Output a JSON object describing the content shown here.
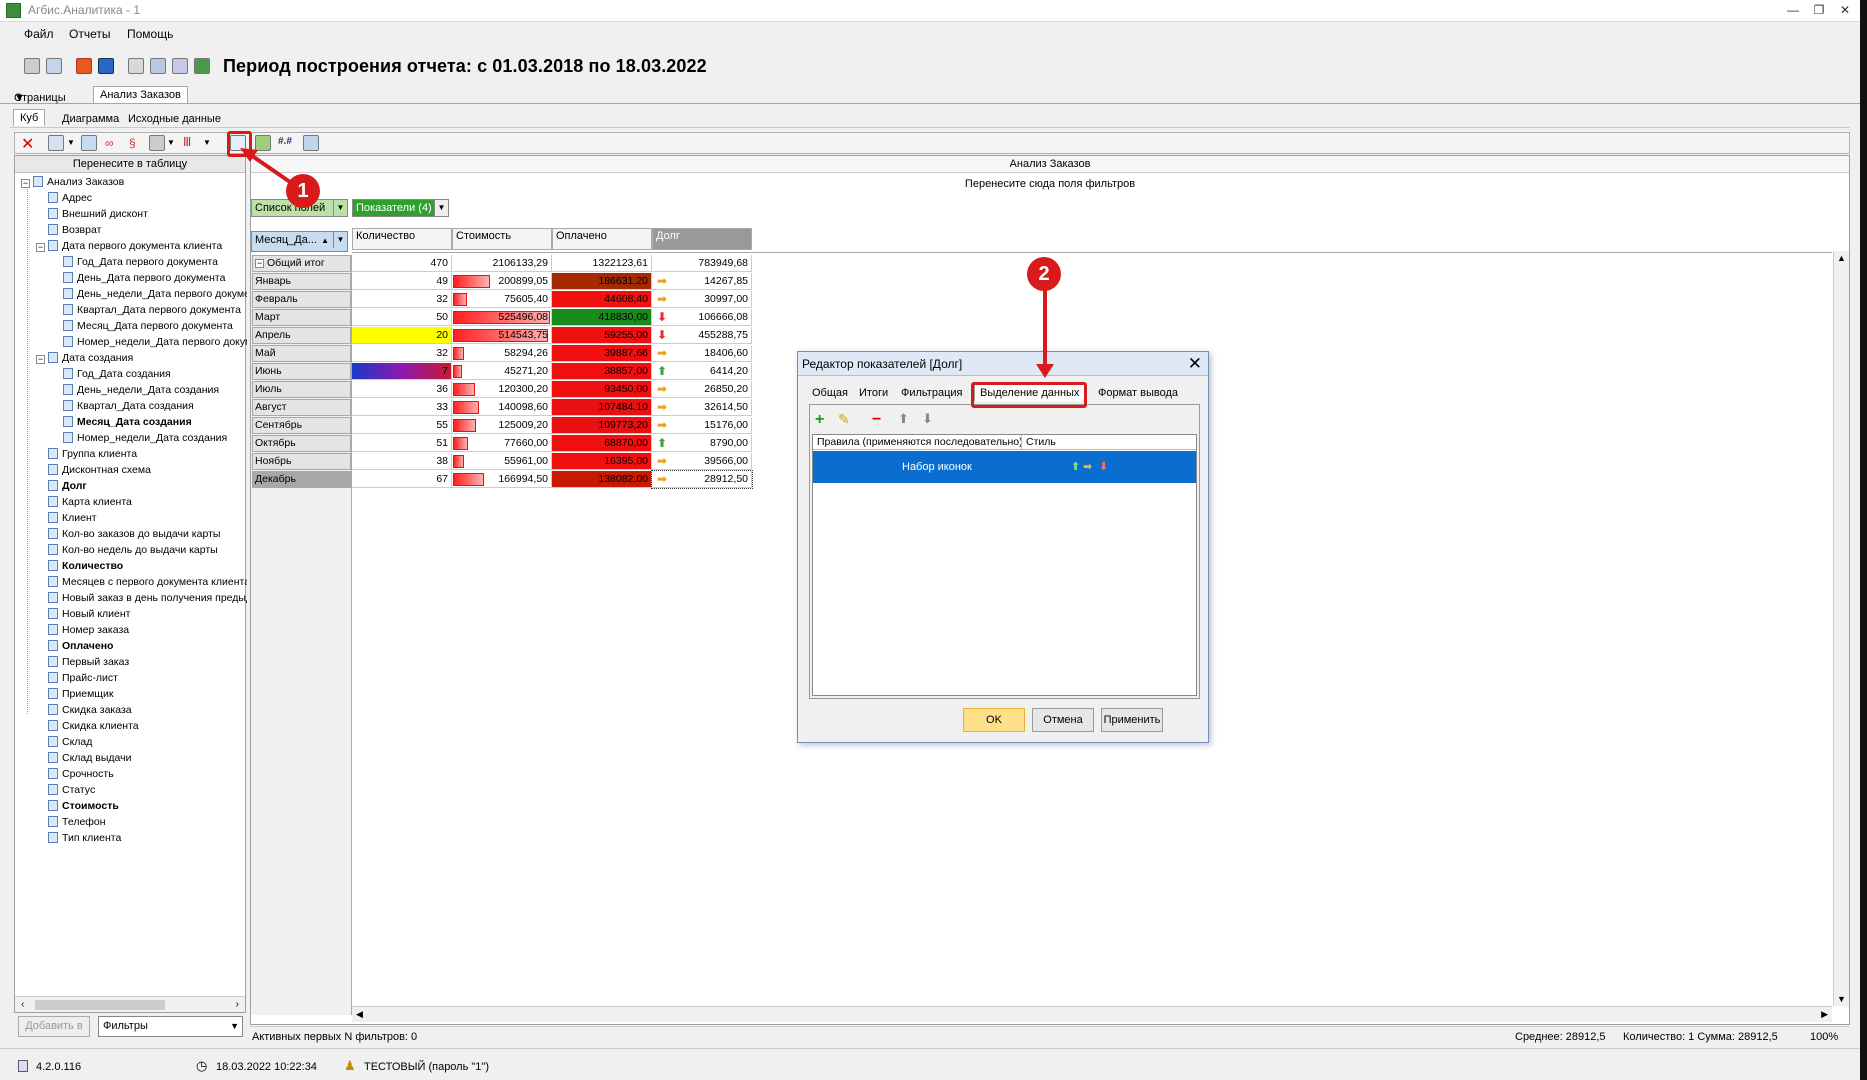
{
  "window": {
    "title": "Агбис.Аналитика - 1",
    "minimize_glyph": "—",
    "restore_glyph": "❐",
    "close_glyph": "✕"
  },
  "menu": [
    "Файл",
    "Отчеты",
    "Помощь"
  ],
  "header": {
    "period": "Период построения отчета: с 01.03.2018 по 18.03.2022"
  },
  "page_tabs": {
    "pages_label": "Страницы",
    "active": "Анализ Заказов"
  },
  "sub_tabs": [
    "Куб",
    "Диаграмма",
    "Исходные данные"
  ],
  "left_panel": {
    "header": "Перенесите в таблицу",
    "tree": [
      {
        "label": "Анализ Заказов",
        "level": 0,
        "expand": true,
        "bold": false
      },
      {
        "label": "Адрес",
        "level": 1,
        "bold": false
      },
      {
        "label": "Внешний дисконт",
        "level": 1,
        "bold": false
      },
      {
        "label": "Возврат",
        "level": 1,
        "bold": false
      },
      {
        "label": "Дата первого документа клиента",
        "level": 1,
        "expand": true,
        "bold": false
      },
      {
        "label": "Год_Дата первого документа",
        "level": 2,
        "bold": false
      },
      {
        "label": "День_Дата первого документа",
        "level": 2,
        "bold": false
      },
      {
        "label": "День_недели_Дата первого документа",
        "level": 2,
        "bold": false
      },
      {
        "label": "Квартал_Дата первого документа",
        "level": 2,
        "bold": false
      },
      {
        "label": "Месяц_Дата первого документа",
        "level": 2,
        "bold": false
      },
      {
        "label": "Номер_недели_Дата первого документа",
        "level": 2,
        "bold": false
      },
      {
        "label": "Дата создания",
        "level": 1,
        "expand": true,
        "bold": false
      },
      {
        "label": "Год_Дата создания",
        "level": 2,
        "bold": false
      },
      {
        "label": "День_недели_Дата создания",
        "level": 2,
        "bold": false
      },
      {
        "label": "Квартал_Дата создания",
        "level": 2,
        "bold": false
      },
      {
        "label": "Месяц_Дата создания",
        "level": 2,
        "bold": true
      },
      {
        "label": "Номер_недели_Дата создания",
        "level": 2,
        "bold": false
      },
      {
        "label": "Группа клиента",
        "level": 1,
        "bold": false
      },
      {
        "label": "Дисконтная схема",
        "level": 1,
        "bold": false
      },
      {
        "label": "Долг",
        "level": 1,
        "bold": true
      },
      {
        "label": "Карта клиента",
        "level": 1,
        "bold": false
      },
      {
        "label": "Клиент",
        "level": 1,
        "bold": false
      },
      {
        "label": "Кол-во заказов до выдачи карты",
        "level": 1,
        "bold": false
      },
      {
        "label": "Кол-во недель до выдачи карты",
        "level": 1,
        "bold": false
      },
      {
        "label": "Количество",
        "level": 1,
        "bold": true
      },
      {
        "label": "Месяцев с первого документа клиента",
        "level": 1,
        "bold": false
      },
      {
        "label": "Новый заказ в день получения предыдущего",
        "level": 1,
        "bold": false
      },
      {
        "label": "Новый клиент",
        "level": 1,
        "bold": false
      },
      {
        "label": "Номер заказа",
        "level": 1,
        "bold": false
      },
      {
        "label": "Оплачено",
        "level": 1,
        "bold": true
      },
      {
        "label": "Первый заказ",
        "level": 1,
        "bold": false
      },
      {
        "label": "Прайс-лист",
        "level": 1,
        "bold": false
      },
      {
        "label": "Приемщик",
        "level": 1,
        "bold": false
      },
      {
        "label": "Скидка заказа",
        "level": 1,
        "bold": false
      },
      {
        "label": "Скидка клиента",
        "level": 1,
        "bold": false
      },
      {
        "label": "Склад",
        "level": 1,
        "bold": false
      },
      {
        "label": "Склад выдачи",
        "level": 1,
        "bold": false
      },
      {
        "label": "Срочность",
        "level": 1,
        "bold": false
      },
      {
        "label": "Статус",
        "level": 1,
        "bold": false
      },
      {
        "label": "Стоимость",
        "level": 1,
        "bold": true
      },
      {
        "label": "Телефон",
        "level": 1,
        "bold": false
      },
      {
        "label": "Тип клиента",
        "level": 1,
        "bold": false
      }
    ],
    "add_button": "Добавить в",
    "filter_select": "Фильтры"
  },
  "cube": {
    "title": "Анализ Заказов",
    "filter_hint": "Перенесите сюда поля фильтров",
    "fields_list": "Список полей",
    "measures": "Показатели (4)",
    "row_field": "Месяц_Да...",
    "columns": [
      "Количество",
      "Стоимость",
      "Оплачено",
      "Долг"
    ],
    "total_label": "Общий итог",
    "rows": [
      {
        "label": "Общий итог",
        "qty": "470",
        "cost": "2106133,29",
        "paid": "1322123,61",
        "debt": "783949,68",
        "arrow": "",
        "qty_bg": "",
        "paid_bg": "",
        "cost_frac": 0
      },
      {
        "label": "Январь",
        "qty": "49",
        "cost": "200899,05",
        "paid": "186631,20",
        "debt": "14267,85",
        "arrow": "right",
        "qty_bg": "",
        "paid_bg": "#a52a00",
        "cost_frac": 0.38
      },
      {
        "label": "Февраль",
        "qty": "32",
        "cost": "75605,40",
        "paid": "44608,40",
        "debt": "30997,00",
        "arrow": "right",
        "qty_bg": "",
        "paid_bg": "#f01010",
        "cost_frac": 0.14
      },
      {
        "label": "Март",
        "qty": "50",
        "cost": "525496,08",
        "paid": "418830,00",
        "debt": "106666,08",
        "arrow": "down",
        "qty_bg": "",
        "paid_bg": "#1a8a1a",
        "cost_frac": 1.0
      },
      {
        "label": "Апрель",
        "qty": "20",
        "cost": "514543,75",
        "paid": "59255,00",
        "debt": "455288,75",
        "arrow": "down",
        "qty_bg": "#ffff00",
        "paid_bg": "#f01010",
        "cost_frac": 0.98
      },
      {
        "label": "Май",
        "qty": "32",
        "cost": "58294,26",
        "paid": "39887,66",
        "debt": "18406,60",
        "arrow": "right",
        "qty_bg": "",
        "paid_bg": "#f01010",
        "cost_frac": 0.11
      },
      {
        "label": "Июнь",
        "qty": "7",
        "cost": "45271,20",
        "paid": "38857,00",
        "debt": "6414,20",
        "arrow": "up",
        "qty_bg": "grad",
        "paid_bg": "#f01010",
        "cost_frac": 0.09
      },
      {
        "label": "Июль",
        "qty": "36",
        "cost": "120300,20",
        "paid": "93450,00",
        "debt": "26850,20",
        "arrow": "right",
        "qty_bg": "",
        "paid_bg": "#f01010",
        "cost_frac": 0.23
      },
      {
        "label": "Август",
        "qty": "33",
        "cost": "140098,60",
        "paid": "107484,10",
        "debt": "32614,50",
        "arrow": "right",
        "qty_bg": "",
        "paid_bg": "#e81010",
        "cost_frac": 0.27
      },
      {
        "label": "Сентябрь",
        "qty": "55",
        "cost": "125009,20",
        "paid": "109773,20",
        "debt": "15176,00",
        "arrow": "right",
        "qty_bg": "",
        "paid_bg": "#e81010",
        "cost_frac": 0.24
      },
      {
        "label": "Октябрь",
        "qty": "51",
        "cost": "77660,00",
        "paid": "68870,00",
        "debt": "8790,00",
        "arrow": "up",
        "qty_bg": "",
        "paid_bg": "#f01010",
        "cost_frac": 0.15
      },
      {
        "label": "Ноябрь",
        "qty": "38",
        "cost": "55961,00",
        "paid": "16395,00",
        "debt": "39566,00",
        "arrow": "right",
        "qty_bg": "",
        "paid_bg": "#f01010",
        "cost_frac": 0.11
      },
      {
        "label": "Декабрь",
        "qty": "67",
        "cost": "166994,50",
        "paid": "138082,00",
        "debt": "28912,50",
        "arrow": "right",
        "qty_bg": "",
        "paid_bg": "#c81a00",
        "cost_frac": 0.32
      }
    ]
  },
  "status": {
    "filters": "Активных первых N фильтров: 0",
    "avg": "Среднее: 28912,5",
    "count_sum": "Количество: 1  Сумма: 28912,5",
    "zoom": "100%"
  },
  "bottom": {
    "version": "4.2.0.116",
    "datetime": "18.03.2022 10:22:34",
    "user": "ТЕСТОВЫЙ (пароль \"1\")"
  },
  "dialog": {
    "title": "Редактор показателей [Долг]",
    "tabs": [
      "Общая",
      "Итоги",
      "Фильтрация",
      "Выделение данных",
      "Формат вывода"
    ],
    "active_tab": "Выделение данных",
    "col_rules": "Правила (применяются последовательно)",
    "col_style": "Стиль",
    "rule": "Набор иконок",
    "ok": "OK",
    "cancel": "Отмена",
    "apply": "Применить"
  },
  "callouts": [
    "1",
    "2"
  ],
  "colors": {
    "accent_red": "#d91a1a",
    "selection": "#0a6ed1"
  }
}
